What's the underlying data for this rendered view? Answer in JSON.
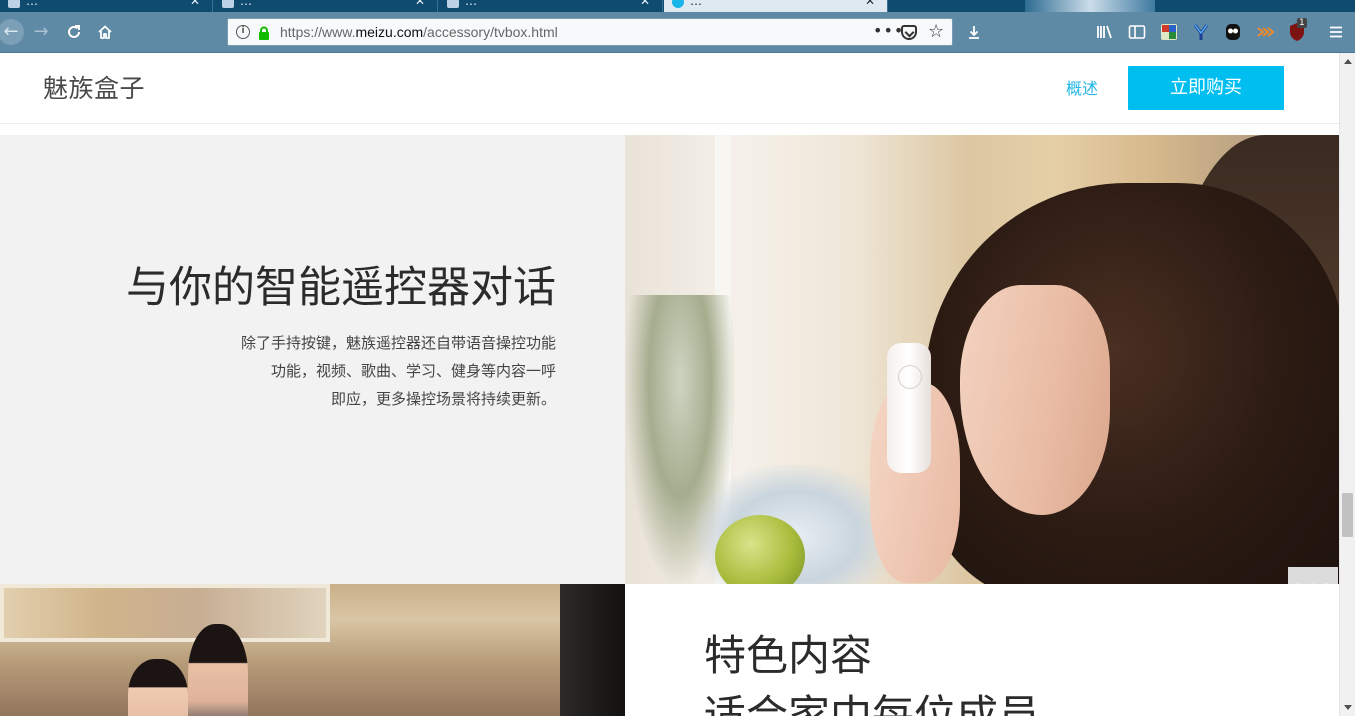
{
  "browser": {
    "tabs": [
      {
        "title": "…",
        "active": false
      },
      {
        "title": "…",
        "active": false
      },
      {
        "title": "…",
        "active": false
      },
      {
        "title": "…",
        "active": true
      }
    ],
    "url": {
      "scheme": "https://www.",
      "host": "meizu.com",
      "path": "/accessory/tvbox.html"
    },
    "toolbar_icons": [
      "library-icon",
      "sidebar-icon",
      "translate-extension-icon",
      "yandex-extension-icon",
      "ghostery-extension-icon",
      "rss-extension-icon",
      "ublock-extension-icon",
      "menu-icon"
    ],
    "ublock_badge": "1"
  },
  "site": {
    "brand": "魅族盒子",
    "nav_overview": "概述",
    "buy_label": "立即购买",
    "accent_color": "#00bff0"
  },
  "feature_voice": {
    "title": "与你的智能遥控器对话",
    "desc_lines": [
      "除了手持按键，魅族遥控器还自带语音操控功能",
      "功能，视频、歌曲、学习、健身等内容一呼",
      "即应，更多操控场景将持续更新。"
    ]
  },
  "feature_content": {
    "title": "特色内容",
    "subtitle": "适合家中每位成员"
  },
  "float_button": "•••"
}
